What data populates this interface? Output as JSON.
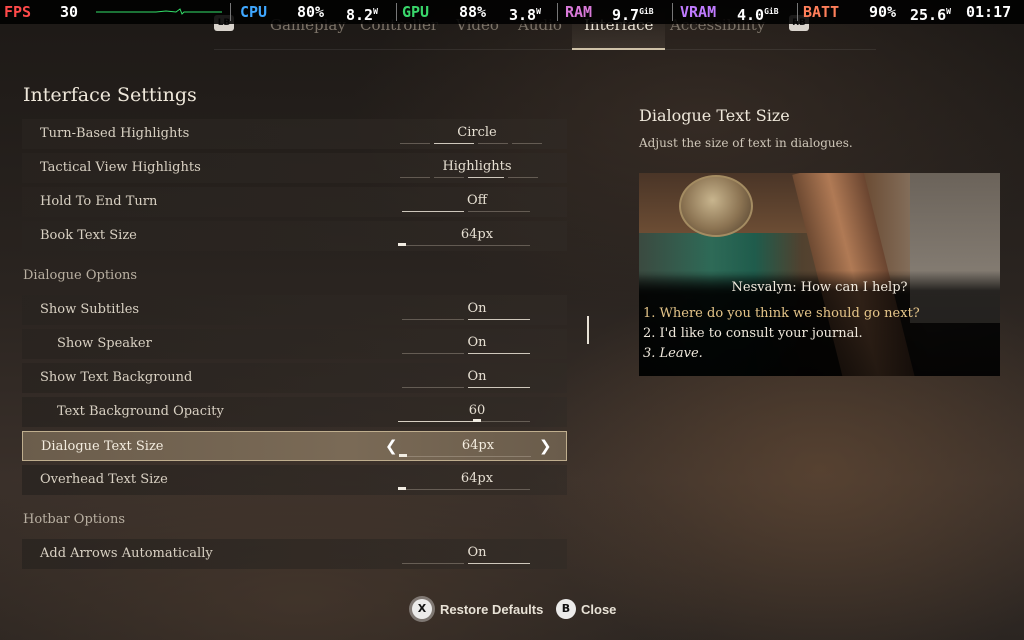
{
  "perf": {
    "fps_label": "FPS",
    "fps_value": "30",
    "cpu_label": "CPU",
    "cpu_pct": "80%",
    "cpu_w": "8.2",
    "cpu_unit": "W",
    "gpu_label": "GPU",
    "gpu_pct": "88%",
    "gpu_w": "3.8",
    "gpu_unit": "W",
    "ram_label": "RAM",
    "ram_value": "9.7",
    "ram_unit": "GiB",
    "vram_label": "VRAM",
    "vram_value": "4.0",
    "vram_unit": "GiB",
    "batt_label": "BATT",
    "batt_pct": "90%",
    "batt_w": "25.6",
    "batt_unit": "W",
    "clock": "01:17",
    "colors": {
      "fps": "#ff4a4a",
      "cpu": "#3fa7ff",
      "gpu": "#39d66a",
      "ram": "#d97ad9",
      "vram": "#c07bff",
      "batt": "#ff7f5a",
      "value": "#ffffff",
      "graph": "#33e06a"
    }
  },
  "tabs": {
    "lb": "LB",
    "rb": "RB",
    "items": [
      "Gameplay",
      "Controller",
      "Video",
      "Audio",
      "Interface",
      "Accessibility"
    ],
    "active": "Interface"
  },
  "panel": {
    "title": "Interface Settings"
  },
  "settings": [
    {
      "label": "Turn-Based Highlights",
      "value": "Circle"
    },
    {
      "label": "Tactical View Highlights",
      "value": "Highlights"
    },
    {
      "label": "Hold To End Turn",
      "value": "Off"
    },
    {
      "label": "Book Text Size",
      "value": "64px"
    }
  ],
  "sections": {
    "dialogue": "Dialogue Options",
    "hotbar": "Hotbar Options"
  },
  "dialogue_settings": [
    {
      "label": "Show Subtitles",
      "value": "On"
    },
    {
      "label": "Show Speaker",
      "value": "On"
    },
    {
      "label": "Show Text Background",
      "value": "On"
    },
    {
      "label": "Text Background Opacity",
      "value": "60",
      "level": 0.6
    },
    {
      "label": "Dialogue Text Size",
      "value": "64px",
      "selected": true
    },
    {
      "label": "Overhead Text Size",
      "value": "64px"
    }
  ],
  "hotbar_settings": [
    {
      "label": "Add Arrows Automatically",
      "value": "On"
    }
  ],
  "description": {
    "title": "Dialogue Text Size",
    "text": "Adjust the size of text in dialogues."
  },
  "preview": {
    "speaker": "Nesvalyn: How can I help?",
    "options": [
      "1. Where do you think we should go next?",
      "2. I'd like to consult your journal.",
      "3. Leave."
    ]
  },
  "footer": {
    "restore_button": "X",
    "restore_label": "Restore Defaults",
    "close_button": "B",
    "close_label": "Close"
  }
}
